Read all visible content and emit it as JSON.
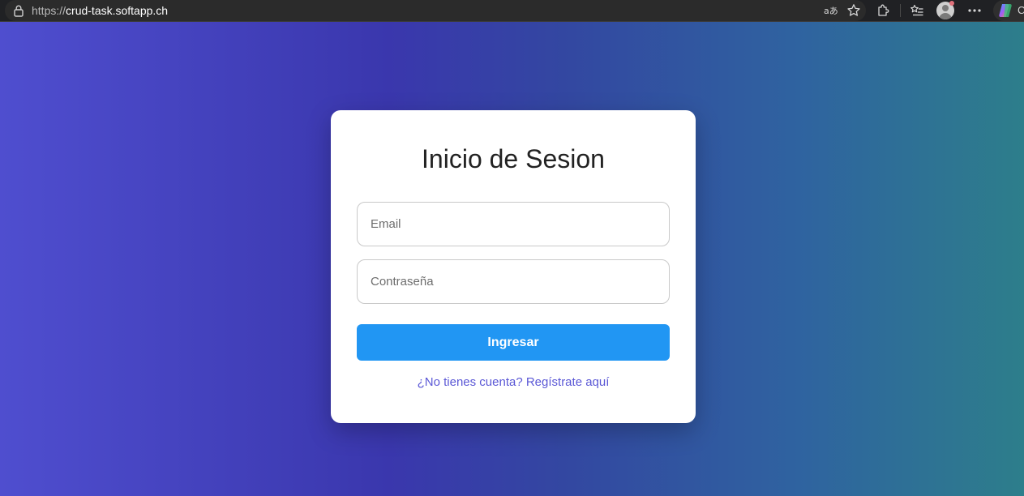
{
  "browser": {
    "url_protocol": "https://",
    "url_host": "crud-task.softapp.ch",
    "copilot_letter": "C"
  },
  "login": {
    "title": "Inicio de Sesion",
    "email": {
      "value": "",
      "placeholder": "Email"
    },
    "password": {
      "value": "",
      "placeholder": "Contraseña"
    },
    "submit_label": "Ingresar",
    "register_link": "¿No tienes cuenta? Regístrate aquí"
  },
  "colors": {
    "button": "#2196f3",
    "link": "#5b58d6",
    "gradient_start": "#4f4ecf",
    "gradient_end": "#2d7e8b"
  },
  "icons": [
    "lock-icon",
    "translate-icon",
    "favorite-star-icon",
    "extensions-icon",
    "favorites-list-icon",
    "profile-avatar-icon",
    "more-options-icon",
    "copilot-icon"
  ]
}
